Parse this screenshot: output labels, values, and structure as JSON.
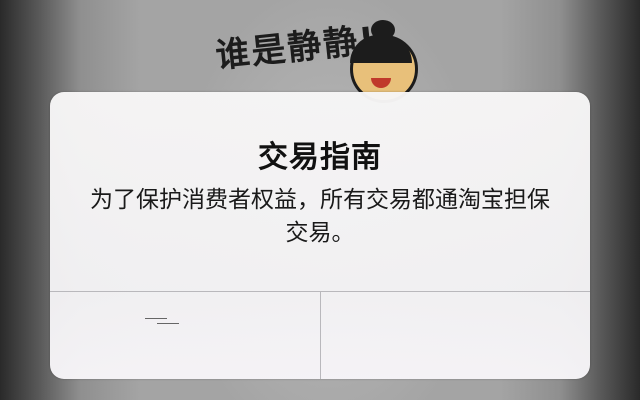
{
  "background": {
    "shirt_text": "谁是静静!"
  },
  "alert": {
    "title": "交易指南",
    "message": "为了保护消费者权益，所有交易都通淘宝担保交易。",
    "buttons": [
      {
        "label": ""
      },
      {
        "label": ""
      }
    ]
  }
}
